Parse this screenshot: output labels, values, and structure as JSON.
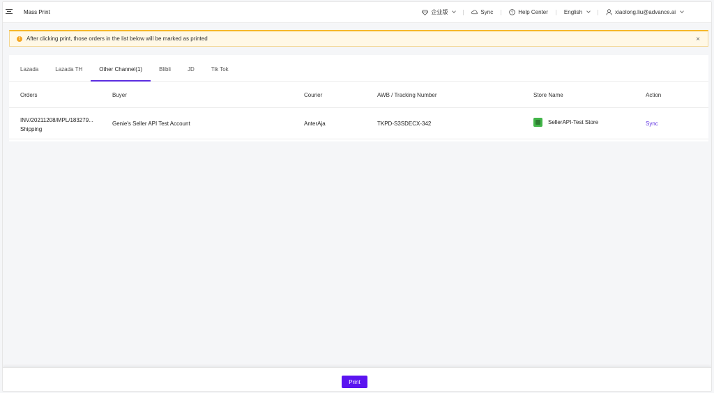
{
  "header": {
    "title": "Mass Print",
    "edition_label": "企业版",
    "sync_label": "Sync",
    "help_label": "Help Center",
    "language_label": "English",
    "user_email": "xiaolong.liu@advance.ai"
  },
  "alert": {
    "message": "After clicking print, those orders in the list below will be marked as printed",
    "close_symbol": "×"
  },
  "tabs": [
    {
      "label": "Lazada"
    },
    {
      "label": "Lazada TH"
    },
    {
      "label": "Other Channel(1)"
    },
    {
      "label": "Blibli"
    },
    {
      "label": "JD"
    },
    {
      "label": "Tik Tok"
    }
  ],
  "table": {
    "headers": [
      "Orders",
      "Buyer",
      "Courier",
      "AWB / Tracking Number",
      "Store Name",
      "Action"
    ],
    "rows": [
      {
        "order": "INV/20211208/MPL/183279...",
        "status": "Shipping",
        "buyer": "Genie's Seller API Test Account",
        "courier": "AnterAja",
        "tracking": "TKPD-S3SDECX-342",
        "store": "SellerAPI-Test Store",
        "action": "Sync"
      }
    ]
  },
  "footer": {
    "print_label": "Print"
  },
  "colors": {
    "accent": "#5b14f0",
    "alert_border": "#f5b72b",
    "alert_bg": "#fff8e6"
  },
  "icons": [
    "menu-icon",
    "diamond-icon",
    "cloud-sync-icon",
    "help-icon",
    "user-icon",
    "warning-icon",
    "close-icon",
    "store-logo-icon"
  ]
}
